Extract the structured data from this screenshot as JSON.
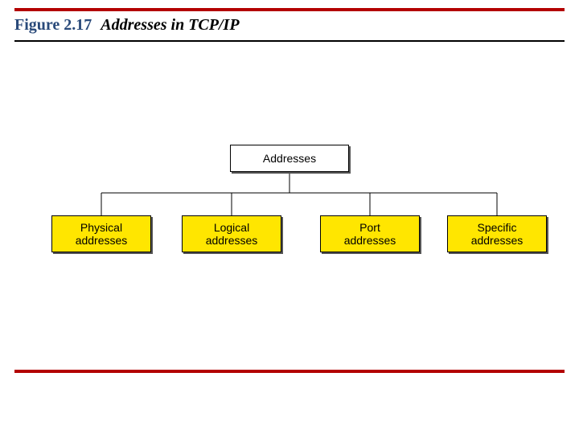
{
  "figure": {
    "number": "Figure 2.17",
    "title": "Addresses in TCP/IP"
  },
  "diagram": {
    "root": {
      "label": "Addresses"
    },
    "children": [
      {
        "label": "Physical\naddresses"
      },
      {
        "label": "Logical\naddresses"
      },
      {
        "label": "Port\naddresses"
      },
      {
        "label": "Specific\naddresses"
      }
    ]
  },
  "colors": {
    "rule": "#b30000",
    "child_fill": "#ffe600"
  }
}
